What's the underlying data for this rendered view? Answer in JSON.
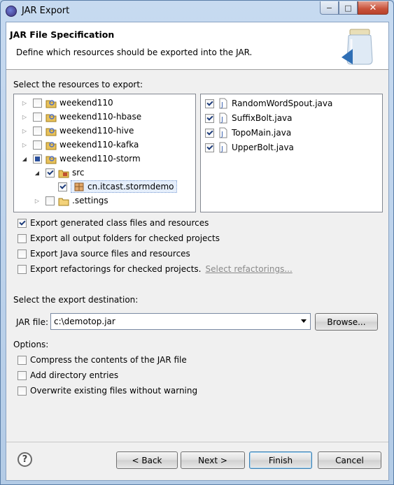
{
  "window": {
    "title": "JAR Export",
    "minimize": "−",
    "maximize": "□",
    "close": "✕"
  },
  "header": {
    "title": "JAR File Specification",
    "description": "Define which resources should be exported into the JAR."
  },
  "resources": {
    "label": "Select the resources to export:",
    "tree": [
      {
        "label": "weekend110",
        "state": "unchecked",
        "expander": "collapsed",
        "icon": "java-project-icon"
      },
      {
        "label": "weekend110-hbase",
        "state": "unchecked",
        "expander": "collapsed",
        "icon": "java-project-icon"
      },
      {
        "label": "weekend110-hive",
        "state": "unchecked",
        "expander": "collapsed",
        "icon": "java-project-icon"
      },
      {
        "label": "weekend110-kafka",
        "state": "unchecked",
        "expander": "collapsed",
        "icon": "java-project-icon"
      },
      {
        "label": "weekend110-storm",
        "state": "partial",
        "expander": "expanded",
        "icon": "java-project-icon"
      },
      {
        "label": "src",
        "state": "checked",
        "expander": "expanded",
        "icon": "source-folder-icon"
      },
      {
        "label": "cn.itcast.stormdemo",
        "state": "checked",
        "expander": "none",
        "icon": "package-icon",
        "selected": true
      },
      {
        "label": ".settings",
        "state": "unchecked",
        "expander": "collapsed",
        "icon": "folder-icon"
      }
    ],
    "files": [
      {
        "label": "RandomWordSpout.java",
        "state": "checked"
      },
      {
        "label": "SuffixBolt.java",
        "state": "checked"
      },
      {
        "label": "TopoMain.java",
        "state": "checked"
      },
      {
        "label": "UpperBolt.java",
        "state": "checked"
      }
    ]
  },
  "export_options": [
    {
      "label": "Export generated class files and resources",
      "checked": true
    },
    {
      "label": "Export all output folders for checked projects",
      "checked": false
    },
    {
      "label": "Export Java source files and resources",
      "checked": false
    },
    {
      "label": "Export refactorings for checked projects.",
      "checked": false,
      "link": "Select refactorings..."
    }
  ],
  "destination": {
    "label": "Select the export destination:",
    "jar_label": "JAR file:",
    "jar_value": "c:\\demotop.jar",
    "browse": "Browse..."
  },
  "options": {
    "label": "Options:",
    "items": [
      {
        "label": "Compress the contents of the JAR file",
        "checked": false
      },
      {
        "label": "Add directory entries",
        "checked": false
      },
      {
        "label": "Overwrite existing files without warning",
        "checked": false
      }
    ]
  },
  "footer": {
    "help": "?",
    "back": "< Back",
    "next": "Next >",
    "finish": "Finish",
    "cancel": "Cancel"
  },
  "colors": {
    "window_frame": "#b9d1ea",
    "close_button": "#c8513a",
    "dialog_bg": "#f0f0f0",
    "link": "#8a8a8a"
  }
}
